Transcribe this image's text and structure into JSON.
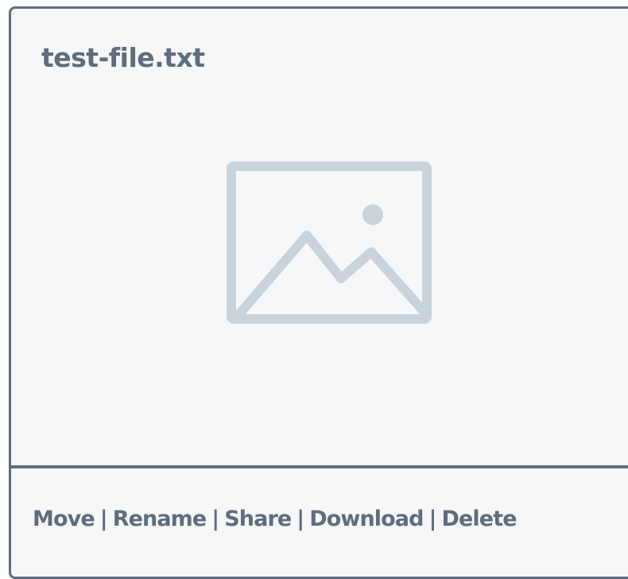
{
  "file": {
    "name": "test-file.txt",
    "preview_icon": "image-placeholder-icon"
  },
  "actions": {
    "separator": "|",
    "move": "Move",
    "rename": "Rename",
    "share": "Share",
    "download": "Download",
    "delete": "Delete"
  },
  "colors": {
    "text": "#5f6d7e",
    "border": "#5f6d7e",
    "card_background": "#f6f7f9",
    "placeholder": "#c9d3dc"
  }
}
